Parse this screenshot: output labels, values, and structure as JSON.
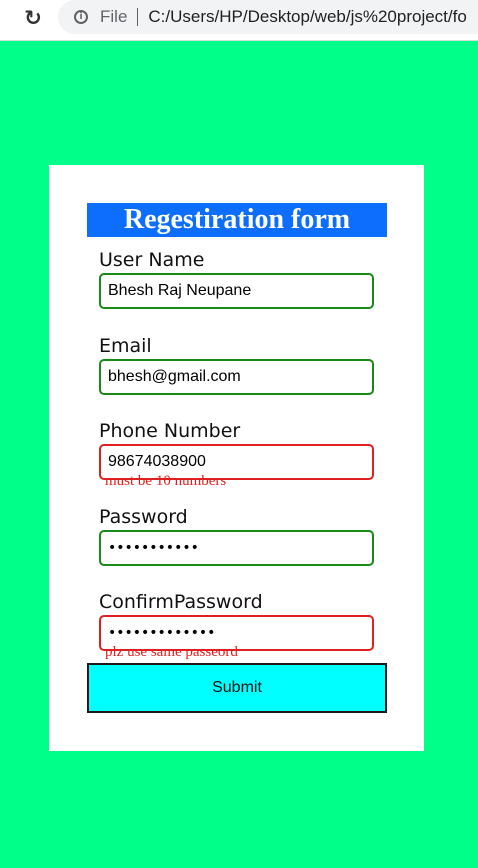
{
  "browser": {
    "reload_icon": "↻",
    "info_icon": "i",
    "file_label": "File",
    "url": "C:/Users/HP/Desktop/web/js%20project/fo"
  },
  "form": {
    "title": "Regestiration form",
    "username": {
      "label": "User Name",
      "value": "Bhesh Raj Neupane",
      "state": "valid"
    },
    "email": {
      "label": "Email",
      "value": "bhesh@gmail.com",
      "state": "valid"
    },
    "phone": {
      "label": "Phone Number",
      "value": "98674038900",
      "state": "error",
      "error": "must be 10 numbers"
    },
    "password": {
      "label": "Password",
      "value": "•••••••••••",
      "state": "valid"
    },
    "confirm": {
      "label": "ConfirmPassword",
      "value": "•••••••••••••",
      "state": "error",
      "error": "plz use same passeord"
    },
    "submit_label": "Submit"
  },
  "colors": {
    "page_background": "#00FF88",
    "title_background": "#0D6EFD",
    "valid_border": "#178A17",
    "error": "#E02020",
    "submit_background": "#00FFFF"
  }
}
